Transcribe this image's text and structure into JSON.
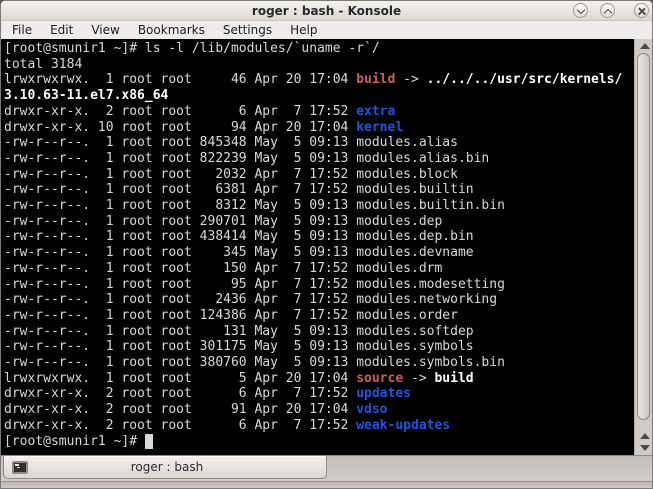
{
  "window": {
    "title": "roger : bash - Konsole",
    "buttons": [
      "minimize",
      "maximize",
      "close"
    ]
  },
  "menu": {
    "items": [
      "File",
      "Edit",
      "View",
      "Bookmarks",
      "Settings",
      "Help"
    ]
  },
  "terminal": {
    "colors": {
      "background": "#000000",
      "foreground": "#d9d9d9",
      "directory": "#1e55e0",
      "symlink": "#cd5c5c",
      "bold": "#ffffff"
    },
    "lines": [
      [
        {
          "t": "[root@smunir1 ~]# ls -l /lib/modules/`uname -r`/",
          "c": "fg"
        }
      ],
      [
        {
          "t": "total 3184",
          "c": "fg"
        }
      ],
      [
        {
          "t": "lrwxrwxrwx.  1 root root     46 Apr 20 17:04 ",
          "c": "fg"
        },
        {
          "t": "build",
          "c": "lnk"
        },
        {
          "t": " -> ",
          "c": "fg"
        },
        {
          "t": "../../../usr/src/kernels/",
          "c": "b"
        }
      ],
      [
        {
          "t": "3.10.63-11.el7.x86_64",
          "c": "b"
        }
      ],
      [
        {
          "t": "drwxr-xr-x.  2 root root      6 Apr  7 17:52 ",
          "c": "fg"
        },
        {
          "t": "extra",
          "c": "dir"
        }
      ],
      [
        {
          "t": "drwxr-xr-x. 10 root root     94 Apr 20 17:04 ",
          "c": "fg"
        },
        {
          "t": "kernel",
          "c": "dir"
        }
      ],
      [
        {
          "t": "-rw-r--r--.  1 root root 845348 May  5 09:13 modules.alias",
          "c": "fg"
        }
      ],
      [
        {
          "t": "-rw-r--r--.  1 root root 822239 May  5 09:13 modules.alias.bin",
          "c": "fg"
        }
      ],
      [
        {
          "t": "-rw-r--r--.  1 root root   2032 Apr  7 17:52 modules.block",
          "c": "fg"
        }
      ],
      [
        {
          "t": "-rw-r--r--.  1 root root   6381 Apr  7 17:52 modules.builtin",
          "c": "fg"
        }
      ],
      [
        {
          "t": "-rw-r--r--.  1 root root   8312 May  5 09:13 modules.builtin.bin",
          "c": "fg"
        }
      ],
      [
        {
          "t": "-rw-r--r--.  1 root root 290701 May  5 09:13 modules.dep",
          "c": "fg"
        }
      ],
      [
        {
          "t": "-rw-r--r--.  1 root root 438414 May  5 09:13 modules.dep.bin",
          "c": "fg"
        }
      ],
      [
        {
          "t": "-rw-r--r--.  1 root root    345 May  5 09:13 modules.devname",
          "c": "fg"
        }
      ],
      [
        {
          "t": "-rw-r--r--.  1 root root    150 Apr  7 17:52 modules.drm",
          "c": "fg"
        }
      ],
      [
        {
          "t": "-rw-r--r--.  1 root root     95 Apr  7 17:52 modules.modesetting",
          "c": "fg"
        }
      ],
      [
        {
          "t": "-rw-r--r--.  1 root root   2436 Apr  7 17:52 modules.networking",
          "c": "fg"
        }
      ],
      [
        {
          "t": "-rw-r--r--.  1 root root 124386 Apr  7 17:52 modules.order",
          "c": "fg"
        }
      ],
      [
        {
          "t": "-rw-r--r--.  1 root root    131 May  5 09:13 modules.softdep",
          "c": "fg"
        }
      ],
      [
        {
          "t": "-rw-r--r--.  1 root root 301175 May  5 09:13 modules.symbols",
          "c": "fg"
        }
      ],
      [
        {
          "t": "-rw-r--r--.  1 root root 380760 May  5 09:13 modules.symbols.bin",
          "c": "fg"
        }
      ],
      [
        {
          "t": "lrwxrwxrwx.  1 root root      5 Apr 20 17:04 ",
          "c": "fg"
        },
        {
          "t": "source",
          "c": "lnk"
        },
        {
          "t": " -> ",
          "c": "fg"
        },
        {
          "t": "build",
          "c": "b"
        }
      ],
      [
        {
          "t": "drwxr-xr-x.  2 root root      6 Apr  7 17:52 ",
          "c": "fg"
        },
        {
          "t": "updates",
          "c": "dir"
        }
      ],
      [
        {
          "t": "drwxr-xr-x.  2 root root     91 Apr 20 17:04 ",
          "c": "fg"
        },
        {
          "t": "vdso",
          "c": "dir"
        }
      ],
      [
        {
          "t": "drwxr-xr-x.  2 root root      6 Apr  7 17:52 ",
          "c": "fg"
        },
        {
          "t": "weak-updates",
          "c": "dir"
        }
      ],
      [
        {
          "t": "[root@smunir1 ~]# ",
          "c": "fg"
        },
        {
          "t": " ",
          "c": "cur"
        }
      ]
    ]
  },
  "tabbar": {
    "tabs": [
      {
        "label": "roger : bash",
        "icon": "konsole-terminal-icon",
        "active": true
      }
    ]
  }
}
